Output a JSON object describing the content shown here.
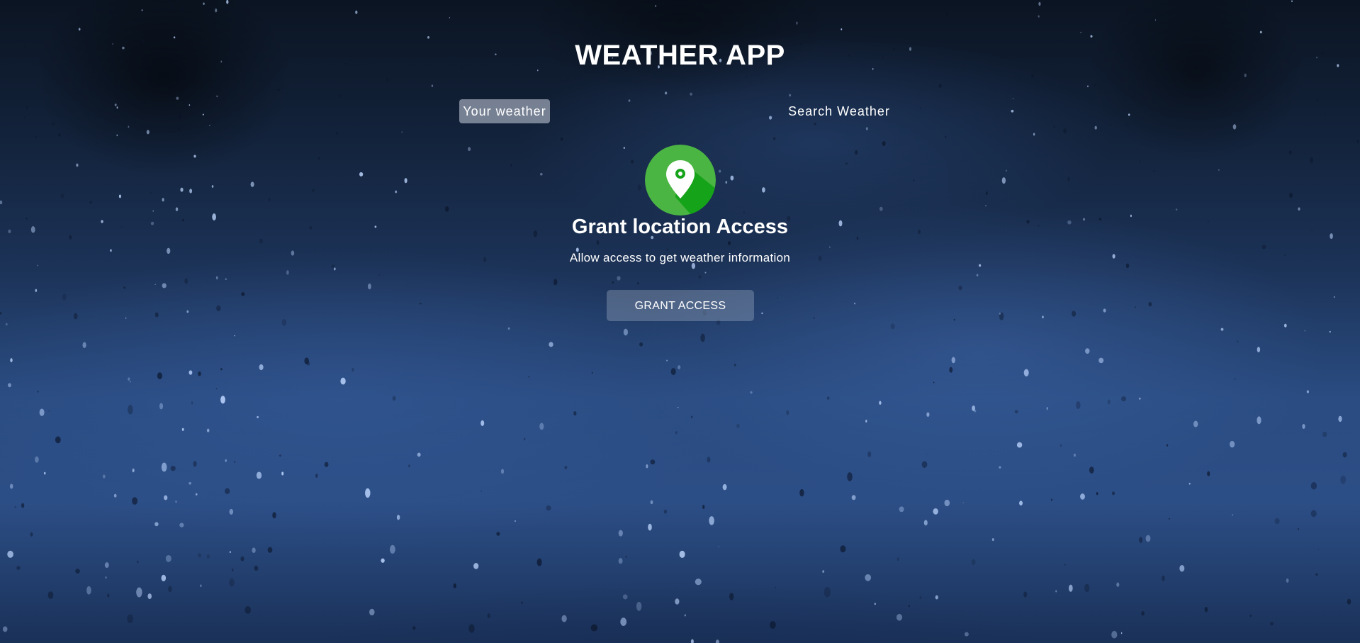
{
  "app": {
    "title": "WEATHER APP"
  },
  "tabs": [
    {
      "label": "Your weather",
      "active": true
    },
    {
      "label": "Search Weather",
      "active": false
    }
  ],
  "grant": {
    "icon": "location-pin-icon",
    "title": "Grant location Access",
    "subtitle": "Allow access to get weather information",
    "button_label": "GRANT ACCESS"
  },
  "colors": {
    "icon_green": "#4bb543",
    "icon_shadow_green": "#15a319",
    "active_tab_bg": "rgba(219,226,239,0.5)",
    "button_bg": "rgba(219,226,239,0.25)",
    "text": "#ffffff"
  }
}
